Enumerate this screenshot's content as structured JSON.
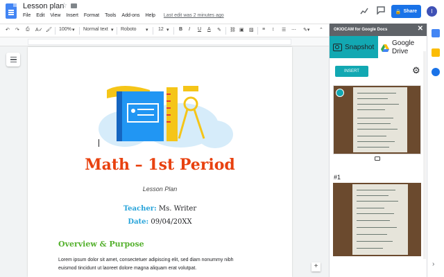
{
  "header": {
    "title": "Lesson plan",
    "menu": [
      "File",
      "Edit",
      "View",
      "Insert",
      "Format",
      "Tools",
      "Add-ons",
      "Help"
    ],
    "last_edit": "Last edit was 2 minutes ago",
    "share_label": "Share",
    "avatar_letter": "I"
  },
  "toolbar": {
    "zoom": "100%",
    "style": "Normal text",
    "font": "Roboto",
    "size": "12"
  },
  "document": {
    "title": "Math – 1st Period",
    "subtitle": "Lesson Plan",
    "teacher_key": "Teacher:",
    "teacher_value": "Ms. Writer",
    "date_key": "Date:",
    "date_value": "09/04/20XX",
    "section_heading": "Overview & Purpose",
    "body_line1": "Lorem ipsum dolor sit amet, consectetuer adipiscing elit, sed diam nonummy nibh",
    "body_line2": "euismod tincidunt ut laoreet dolore magna aliquam erat volutpat."
  },
  "sidebar": {
    "title": "OKIOCAM for Google Docs",
    "tab_snapshot": "Snapshot",
    "tab_drive_line1": "Google",
    "tab_drive_line2": "Drive",
    "insert_label": "INSERT",
    "snapshot_number": "#1"
  },
  "colors": {
    "accent_teal": "#12a8b2",
    "title_red": "#e8410f",
    "label_blue": "#26a3d9",
    "section_green": "#55b12e",
    "share_blue": "#1a73e8"
  }
}
